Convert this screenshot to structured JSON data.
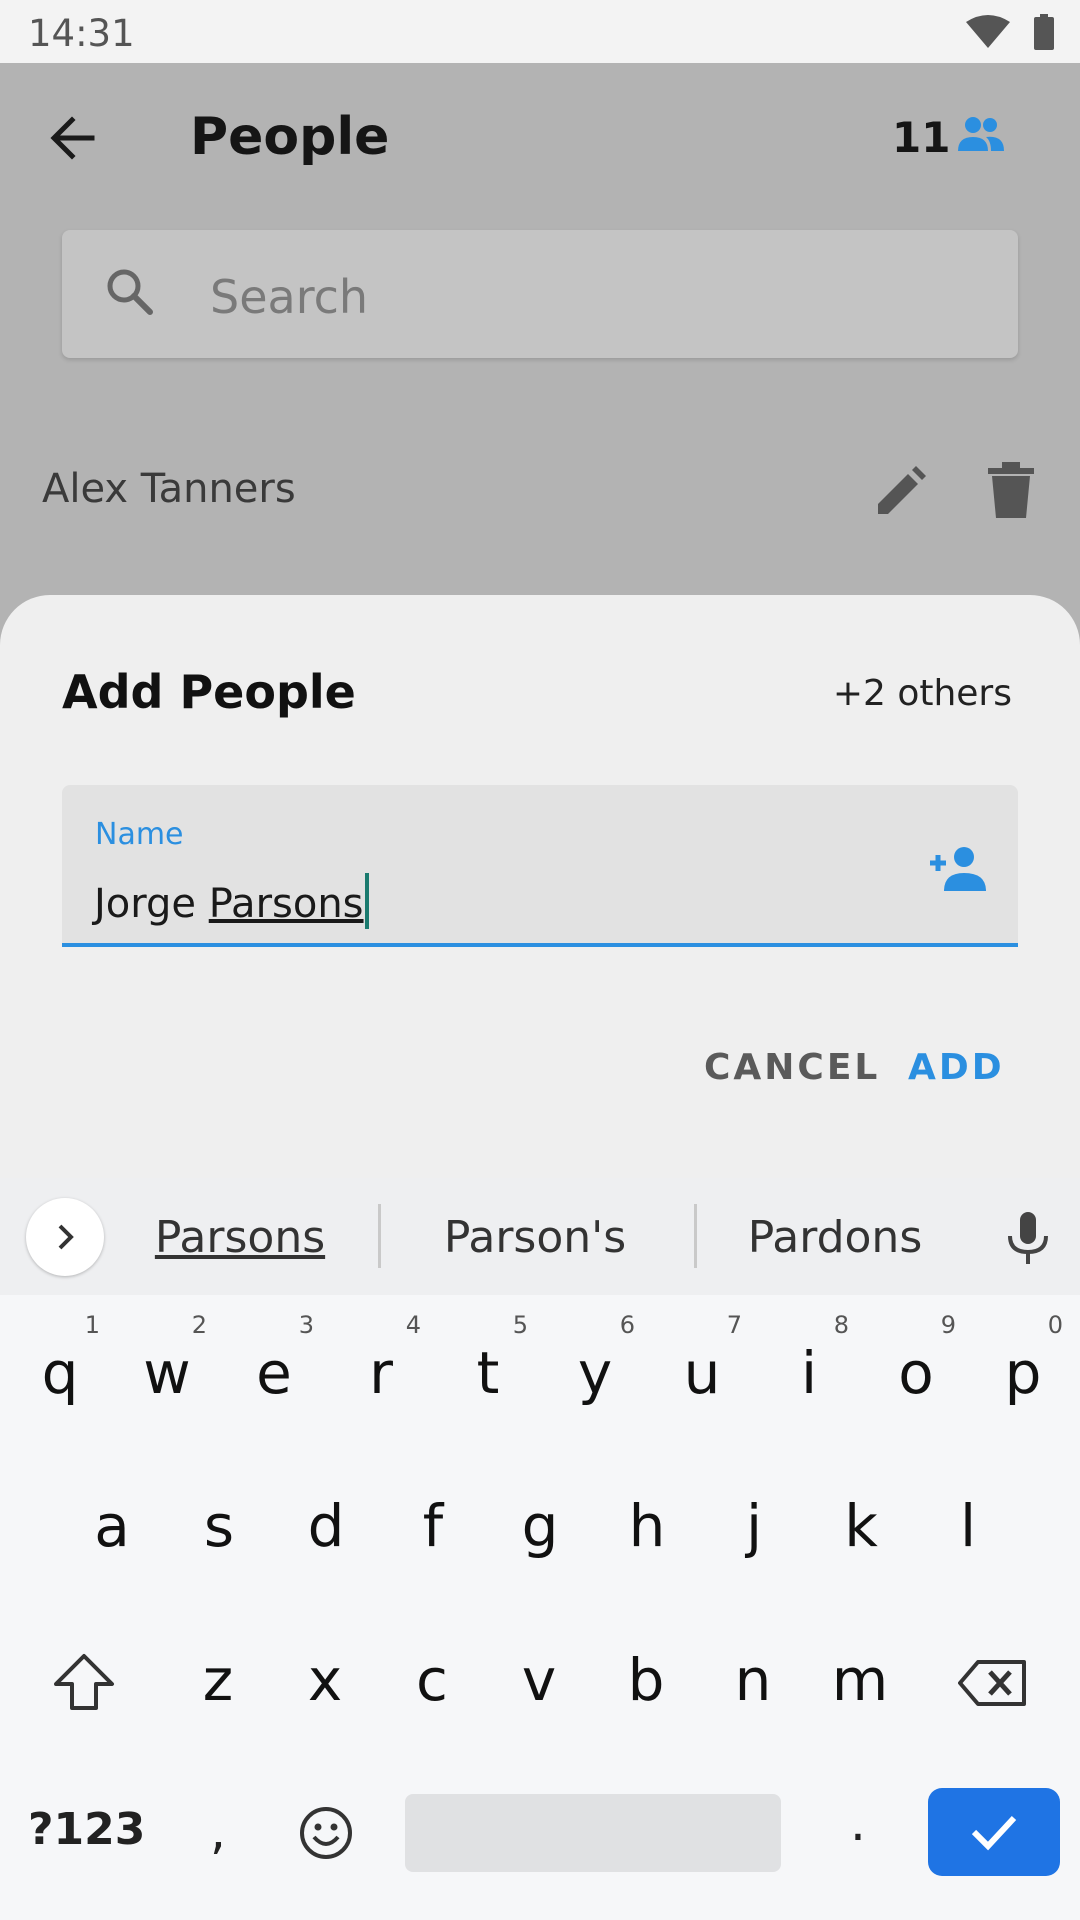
{
  "status_bar": {
    "time": "14:31",
    "icons": [
      "wifi-icon",
      "battery-icon"
    ]
  },
  "app_bar": {
    "title": "People",
    "count": "11",
    "back_icon": "arrow-back-icon",
    "count_icon": "people-icon"
  },
  "search": {
    "placeholder": "Search",
    "icon": "search-icon"
  },
  "people": [
    {
      "name": "Alex Tanners",
      "actions": [
        "edit-icon",
        "delete-icon"
      ]
    }
  ],
  "sheet": {
    "title": "Add People",
    "others": "+2 others",
    "field": {
      "label": "Name",
      "value_prefix": "Jorge ",
      "value_composing": "Parsons",
      "icon": "person-add-icon"
    },
    "cancel_label": "CANCEL",
    "add_label": "ADD"
  },
  "keyboard": {
    "suggestions": [
      "Parsons",
      "Parson's",
      "Pardons"
    ],
    "row1": [
      {
        "k": "q",
        "h": "1"
      },
      {
        "k": "w",
        "h": "2"
      },
      {
        "k": "e",
        "h": "3"
      },
      {
        "k": "r",
        "h": "4"
      },
      {
        "k": "t",
        "h": "5"
      },
      {
        "k": "y",
        "h": "6"
      },
      {
        "k": "u",
        "h": "7"
      },
      {
        "k": "i",
        "h": "8"
      },
      {
        "k": "o",
        "h": "9"
      },
      {
        "k": "p",
        "h": "0"
      }
    ],
    "row2": [
      "a",
      "s",
      "d",
      "f",
      "g",
      "h",
      "j",
      "k",
      "l"
    ],
    "row3": [
      "z",
      "x",
      "c",
      "v",
      "b",
      "n",
      "m"
    ],
    "symbols_label": "?123",
    "comma": ",",
    "period": "."
  },
  "colors": {
    "accent": "#2b8fe0",
    "enter": "#1f74e4",
    "scrim": "#b3b3b3",
    "sheet": "#efefef"
  }
}
